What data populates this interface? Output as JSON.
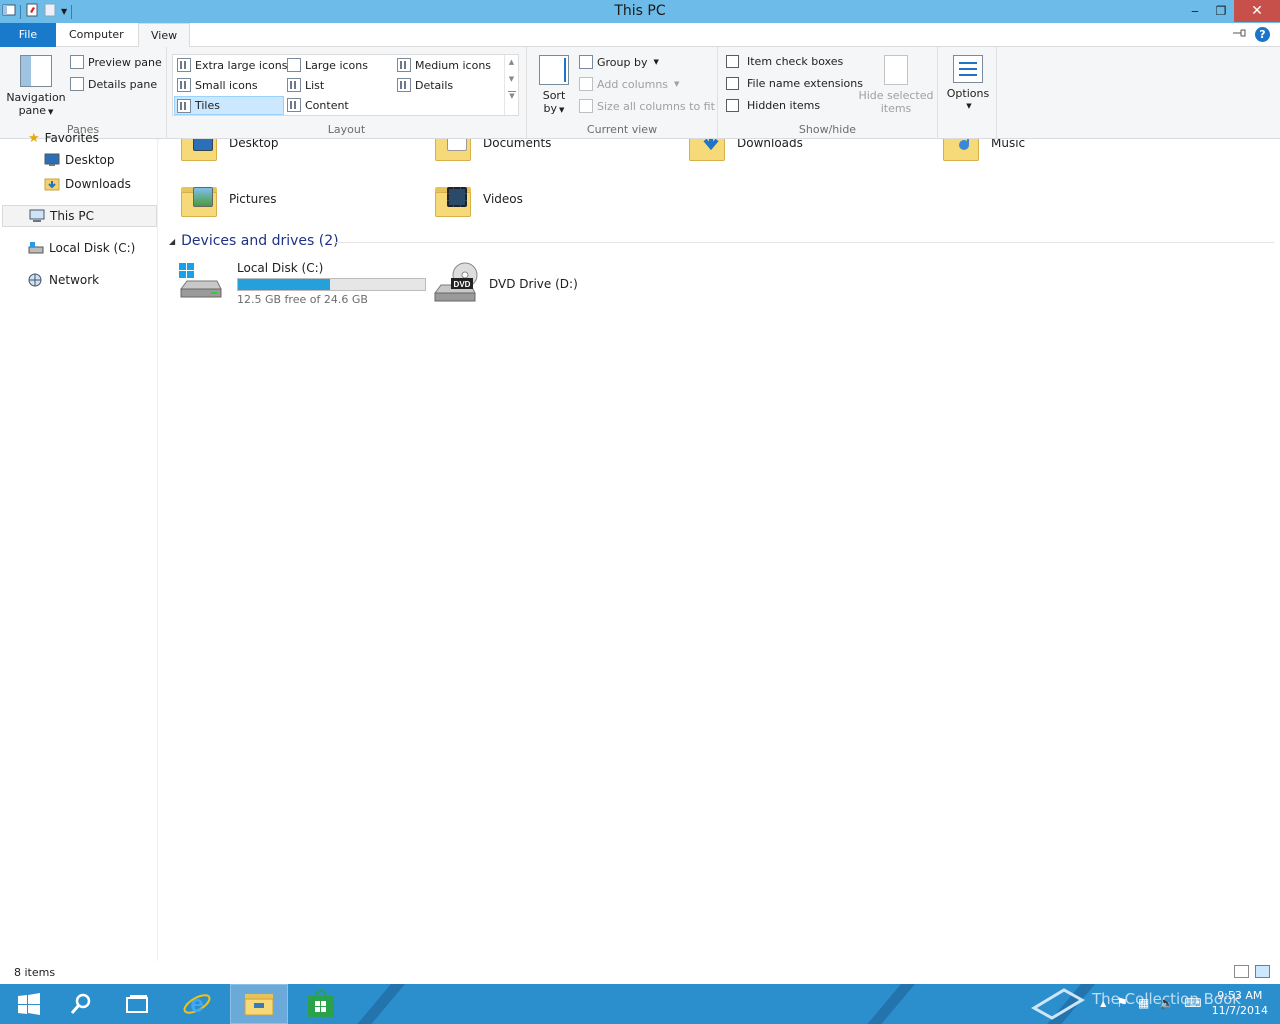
{
  "window": {
    "title": "This PC"
  },
  "titlebar": {
    "minimize": "‒",
    "maximize": "❐",
    "close": "✕"
  },
  "tabs": {
    "file": "File",
    "computer": "Computer",
    "view": "View",
    "help": "?"
  },
  "ribbon": {
    "panes": {
      "label": "Panes",
      "navigation_pane": "Navigation",
      "navigation_pane_2": "pane",
      "preview_pane": "Preview pane",
      "details_pane": "Details pane"
    },
    "layout": {
      "label": "Layout",
      "extra_large_icons": "Extra large icons",
      "large_icons": "Large icons",
      "medium_icons": "Medium icons",
      "small_icons": "Small icons",
      "list": "List",
      "details": "Details",
      "tiles": "Tiles",
      "content": "Content"
    },
    "current_view": {
      "label": "Current view",
      "sort_by": "Sort",
      "sort_by_2": "by",
      "group_by": "Group by",
      "add_columns": "Add columns",
      "size_all_columns": "Size all columns to fit"
    },
    "show_hide": {
      "label": "Show/hide",
      "item_check_boxes": "Item check boxes",
      "file_name_extensions": "File name extensions",
      "hidden_items": "Hidden items",
      "hide_selected": "Hide selected",
      "hide_selected_2": "items"
    },
    "options": {
      "label": "Options"
    }
  },
  "navpane": {
    "favorites": "Favorites",
    "desktop": "Desktop",
    "downloads": "Downloads",
    "this_pc": "This PC",
    "local_disk": "Local Disk (C:)",
    "network": "Network"
  },
  "content": {
    "folders": [
      "Desktop",
      "Documents",
      "Downloads",
      "Music",
      "Pictures",
      "Videos"
    ],
    "section_title": "Devices and drives (2)",
    "drive_c": {
      "name": "Local Disk (C:)",
      "free_text": "12.5 GB free of 24.6 GB",
      "used_fraction": 0.49
    },
    "drive_d": {
      "name": "DVD Drive (D:)",
      "badge": "DVD"
    }
  },
  "statusbar": {
    "item_count": "8 items"
  },
  "taskbar": {
    "clock_time": "9:53 AM",
    "clock_date": "11/7/2014",
    "watermark": "The Collection Book"
  },
  "colors": {
    "titlebar": "#6cbbe8",
    "file_tab": "#1979ca",
    "taskbar": "#2b8fce",
    "progress": "#26a0da",
    "section": "#1e3287"
  }
}
